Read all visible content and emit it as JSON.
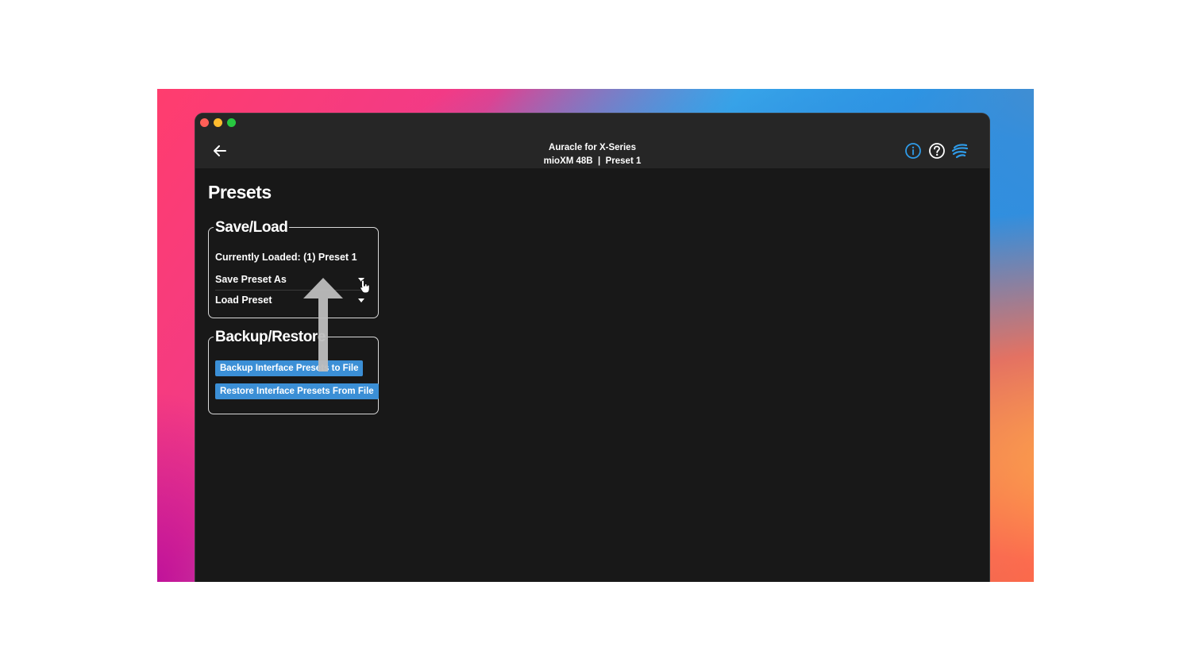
{
  "window": {
    "app_title": "Auracle for X-Series",
    "subtitle": "mioXM 48B  |  Preset 1"
  },
  "header": {
    "back_icon": "arrow-left-icon",
    "icons": [
      "info-icon",
      "help-icon",
      "brand-logo-icon"
    ],
    "accent_color": "#2f9be8"
  },
  "page": {
    "title": "Presets"
  },
  "save_load": {
    "heading": "Save/Load",
    "currently_loaded": "Currently Loaded: (1) Preset 1",
    "save_preset_label": "Save Preset As",
    "load_preset_label": "Load Preset"
  },
  "backup_restore": {
    "heading": "Backup/Restore",
    "backup_button": "Backup Interface Presets to File",
    "restore_button": "Restore Interface Presets From File",
    "button_color": "#3b8fd6"
  }
}
